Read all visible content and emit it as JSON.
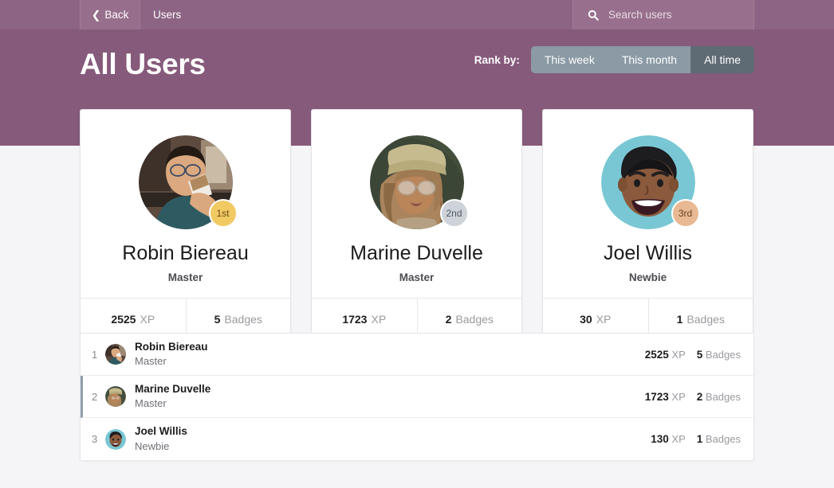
{
  "topbar": {
    "back_label": "Back",
    "breadcrumb": "Users",
    "search_placeholder": "Search users",
    "search_value": "",
    "search_icon": "search-icon",
    "back_icon": "chevron-left-icon"
  },
  "hero": {
    "title": "All Users",
    "rank_label": "Rank by:",
    "rank_options": [
      {
        "label": "This week",
        "selected": false
      },
      {
        "label": "This month",
        "selected": false
      },
      {
        "label": "All time",
        "selected": true
      }
    ]
  },
  "podium": [
    {
      "name": "Robin Biereau",
      "role": "Master",
      "rank_chip": "1st",
      "chip_color": "#f2ca63",
      "xp_value": "2525",
      "xp_label": "XP",
      "badges_value": "5",
      "badges_label": "Badges",
      "avatar": "photo-man-drinking-coffee"
    },
    {
      "name": "Marine Duvelle",
      "role": "Master",
      "rank_chip": "2nd",
      "chip_color": "#cdd3d8",
      "xp_value": "1723",
      "xp_label": "XP",
      "badges_value": "2",
      "badges_label": "Badges",
      "avatar": "photo-woman-beanie-glasses"
    },
    {
      "name": "Joel Willis",
      "role": "Newbie",
      "rank_chip": "3rd",
      "chip_color": "#e8b992",
      "xp_value": "30",
      "xp_label": "XP",
      "badges_value": "1",
      "badges_label": "Badges",
      "avatar": "illustration-smiling-man-teal"
    }
  ],
  "list": [
    {
      "rank": "1",
      "name": "Robin Biereau",
      "role": "Master",
      "xp_value": "2525",
      "xp_label": "XP",
      "badges_value": "5",
      "badges_label": "Badges",
      "selected": false
    },
    {
      "rank": "2",
      "name": "Marine Duvelle",
      "role": "Master",
      "xp_value": "1723",
      "xp_label": "XP",
      "badges_value": "2",
      "badges_label": "Badges",
      "selected": true
    },
    {
      "rank": "3",
      "name": "Joel Willis",
      "role": "Newbie",
      "xp_value": "130",
      "xp_label": "XP",
      "badges_value": "1",
      "badges_label": "Badges",
      "selected": false
    }
  ]
}
